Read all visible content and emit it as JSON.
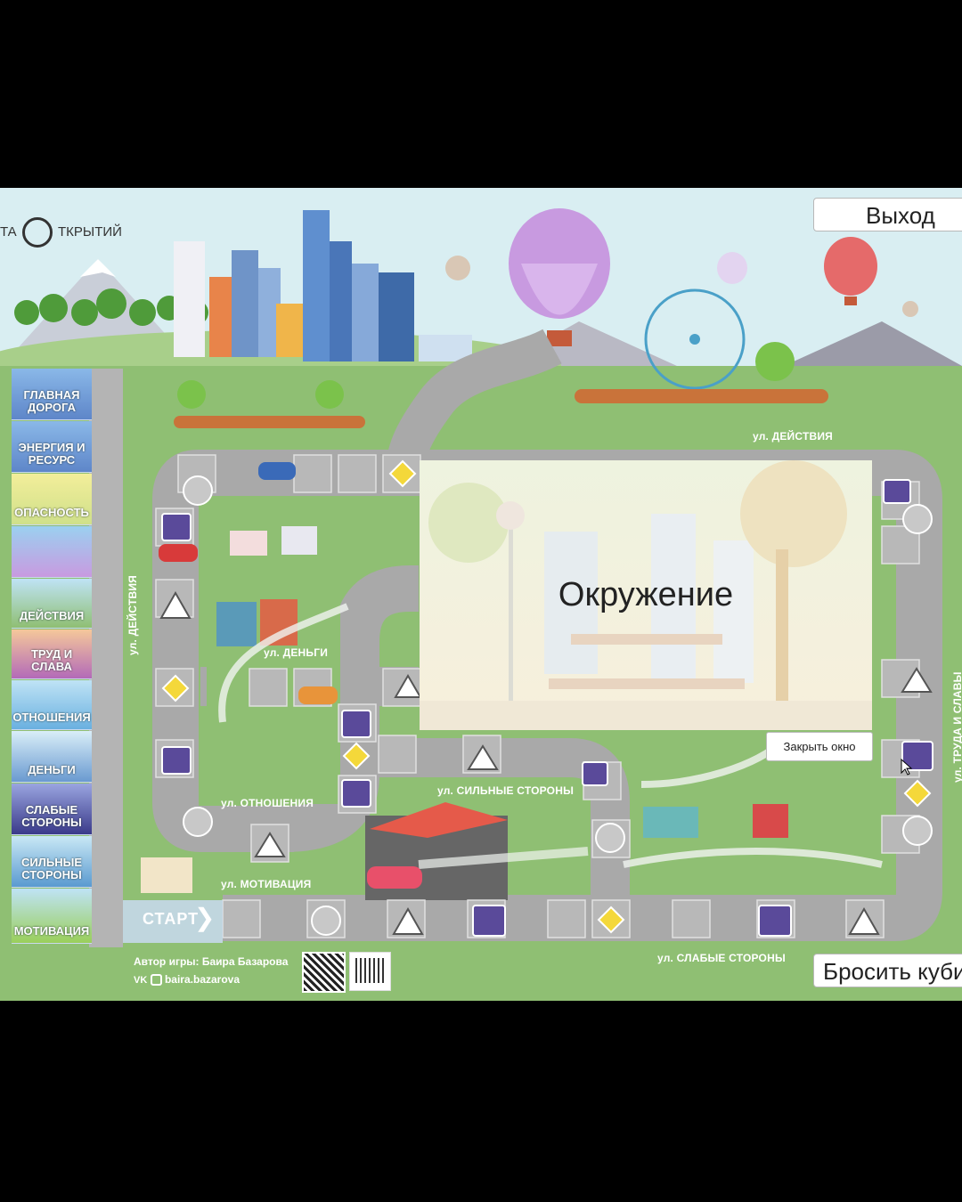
{
  "logo": {
    "text_left": "ТА",
    "text_right": "ТКРЫТИЙ"
  },
  "buttons": {
    "exit": "Выход",
    "roll_dice": "Бросить кубик",
    "close_window": "Закрыть окно"
  },
  "legend": [
    {
      "label": "ГЛАВНАЯ ДОРОГА"
    },
    {
      "label": "ЭНЕРГИЯ И РЕСУРС"
    },
    {
      "label": "ОПАСНОСТЬ"
    },
    {
      "label": ""
    },
    {
      "label": "ДЕЙСТВИЯ"
    },
    {
      "label": "ТРУД И СЛАВА"
    },
    {
      "label": "ОТНОШЕНИЯ"
    },
    {
      "label": "ДЕНЬГИ"
    },
    {
      "label": "СЛАБЫЕ СТОРОНЫ"
    },
    {
      "label": "СИЛЬНЫЕ СТОРОНЫ"
    },
    {
      "label": "МОТИВАЦИЯ"
    }
  ],
  "streets": {
    "actions_top": "ул. ДЕЙСТВИЯ",
    "actions_left": "ул. ДЕЙСТВИЯ",
    "money": "ул. ДЕНЬГИ",
    "relations": "ул. ОТНОШЕНИЯ",
    "strong": "ул. СИЛЬНЫЕ СТОРОНЫ",
    "motivation": "ул. МОТИВАЦИЯ",
    "weak": "ул. СЛАБЫЕ СТОРОНЫ",
    "labor": "ул. ТРУДА И СЛАВЫ"
  },
  "start_label": "СТАРТ",
  "modal": {
    "title": "Окружение"
  },
  "author": {
    "line1": "Автор игры: Баира Базарова",
    "line2": "baira.bazarova"
  },
  "colors": {
    "grass": "#8fbf73",
    "road": "#a9a9a9",
    "sky": "#d9eef2",
    "accent_purple": "#5a4a9a",
    "sign_yellow": "#f4d83a"
  }
}
